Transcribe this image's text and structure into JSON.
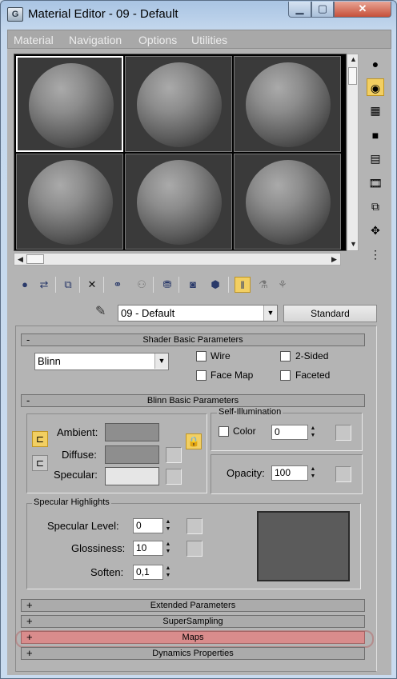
{
  "window": {
    "title": "Material Editor - 09 - Default",
    "app_icon": "3ds-max-app-icon",
    "controls": [
      "minimize",
      "maximize",
      "close"
    ]
  },
  "menu": {
    "items": [
      "Material",
      "Navigation",
      "Options",
      "Utilities"
    ]
  },
  "sample_slots": {
    "count": 6,
    "active_index": 0
  },
  "right_toolbar": {
    "icons": [
      "sample-type-sphere-icon",
      "backlight-icon",
      "background-checker-icon",
      "sample-uv-tiling-icon",
      "video-color-check-icon",
      "make-preview-icon",
      "options-icon",
      "select-by-material-icon",
      "material-map-navigator-icon"
    ],
    "active": "backlight-icon"
  },
  "bottom_toolbar": {
    "icons": [
      "get-material-icon",
      "put-to-scene-icon",
      "assign-to-selection-icon",
      "reset-map-icon",
      "make-unique-icon",
      "put-to-library-icon",
      "material-id-icon",
      "show-map-in-viewport-icon",
      "show-end-result-icon",
      "go-to-parent-icon",
      "go-forward-to-sibling-icon"
    ],
    "active": "show-end-result-icon"
  },
  "material_name": {
    "picker_icon": "eyedropper-icon",
    "value": "09 - Default",
    "type_button": "Standard"
  },
  "shader_basic": {
    "title": "Shader Basic Parameters",
    "sign": "-",
    "shader": "Blinn",
    "wire": "Wire",
    "two_sided": "2-Sided",
    "face_map": "Face Map",
    "faceted": "Faceted"
  },
  "blinn_basic": {
    "title": "Blinn Basic Parameters",
    "sign": "-",
    "ambient": "Ambient:",
    "diffuse": "Diffuse:",
    "specular": "Specular:",
    "self_illumination": {
      "title": "Self-Illumination",
      "color_label": "Color",
      "value": "0"
    },
    "opacity_label": "Opacity:",
    "opacity_value": "100",
    "specular_highlights": {
      "title": "Specular Highlights",
      "level_label": "Specular Level:",
      "level_value": "0",
      "glossiness_label": "Glossiness:",
      "glossiness_value": "10",
      "soften_label": "Soften:",
      "soften_value": "0,1"
    },
    "colors": {
      "ambient": "#8e8e8e",
      "diffuse": "#8e8e8e",
      "specular": "#e6e6e6"
    }
  },
  "collapsed_rollouts": [
    {
      "title": "Extended Parameters",
      "sign": "+"
    },
    {
      "title": "SuperSampling",
      "sign": "+"
    },
    {
      "title": "Maps",
      "sign": "+"
    },
    {
      "title": "Dynamics Properties",
      "sign": "+"
    }
  ],
  "highlight_color": "#d98c8c"
}
